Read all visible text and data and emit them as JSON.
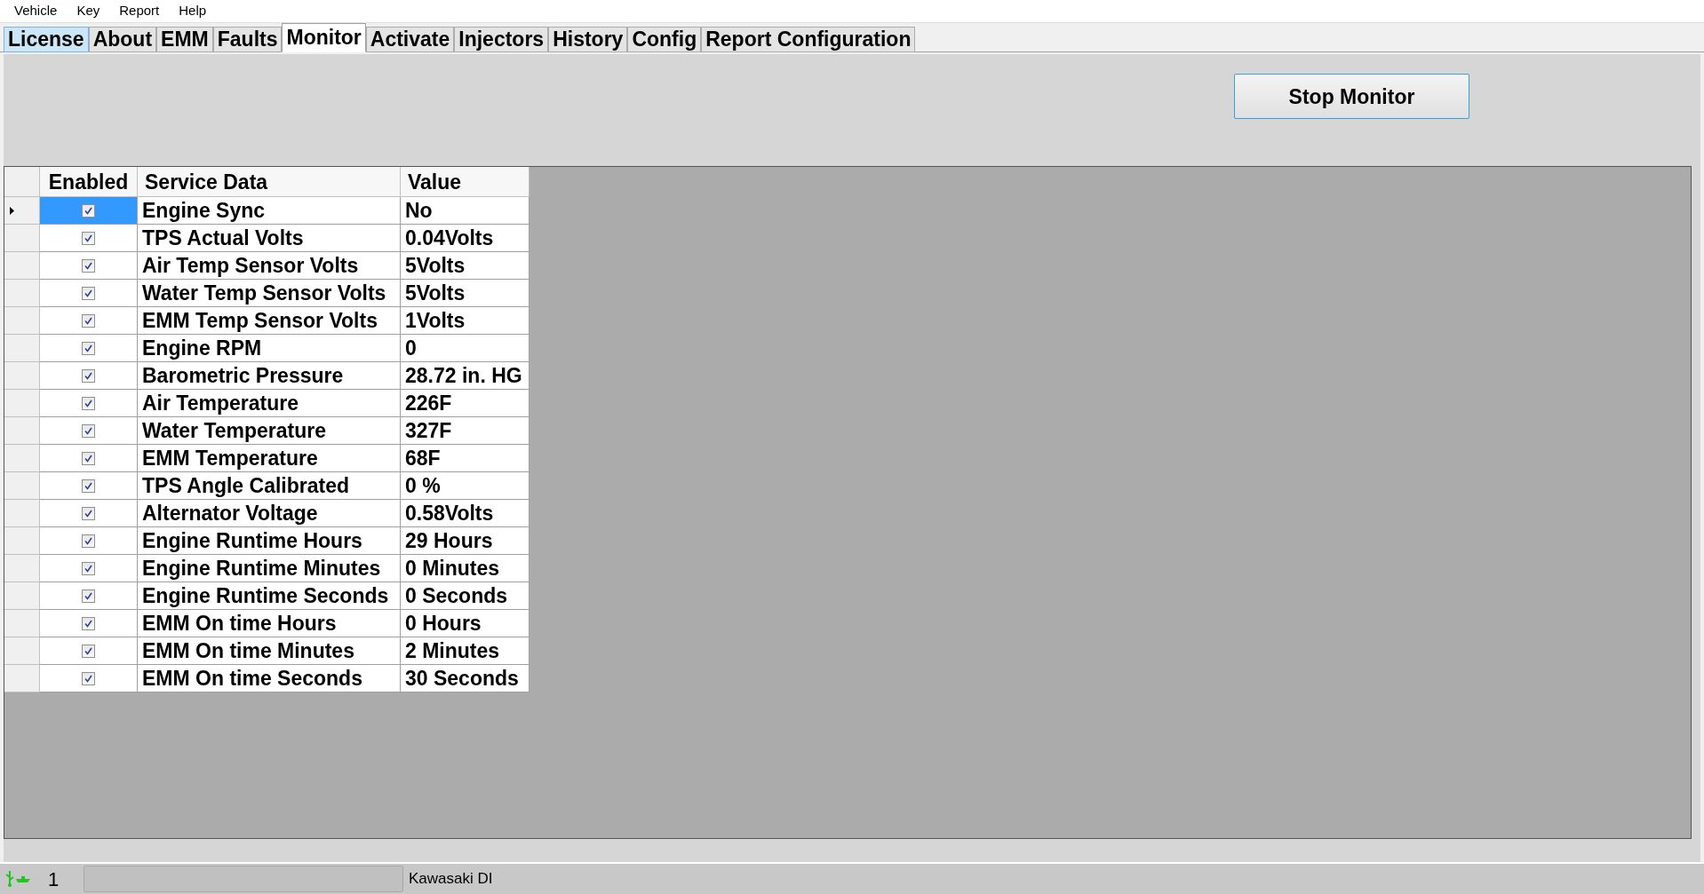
{
  "menu": [
    "Vehicle",
    "Key",
    "Report",
    "Help"
  ],
  "tabs": [
    {
      "label": "License",
      "selected": false,
      "highlighted": true
    },
    {
      "label": "About",
      "selected": false,
      "highlighted": false
    },
    {
      "label": "EMM",
      "selected": false,
      "highlighted": false
    },
    {
      "label": "Faults",
      "selected": false,
      "highlighted": false
    },
    {
      "label": "Monitor",
      "selected": true,
      "highlighted": false
    },
    {
      "label": "Activate",
      "selected": false,
      "highlighted": false
    },
    {
      "label": "Injectors",
      "selected": false,
      "highlighted": false
    },
    {
      "label": "History",
      "selected": false,
      "highlighted": false
    },
    {
      "label": "Config",
      "selected": false,
      "highlighted": false
    },
    {
      "label": "Report Configuration",
      "selected": false,
      "highlighted": false
    }
  ],
  "stop_button": "Stop Monitor",
  "table": {
    "columns": [
      "Enabled",
      "Service Data",
      "Value"
    ],
    "rows": [
      {
        "enabled": true,
        "selected": true,
        "name": "Engine Sync",
        "value": "No"
      },
      {
        "enabled": true,
        "selected": false,
        "name": "TPS Actual Volts",
        "value": "0.04Volts"
      },
      {
        "enabled": true,
        "selected": false,
        "name": "Air Temp Sensor Volts",
        "value": "5Volts"
      },
      {
        "enabled": true,
        "selected": false,
        "name": "Water Temp Sensor Volts",
        "value": "5Volts"
      },
      {
        "enabled": true,
        "selected": false,
        "name": "EMM Temp Sensor Volts",
        "value": "1Volts"
      },
      {
        "enabled": true,
        "selected": false,
        "name": "Engine RPM",
        "value": "0"
      },
      {
        "enabled": true,
        "selected": false,
        "name": "Barometric Pressure",
        "value": "28.72 in. HG"
      },
      {
        "enabled": true,
        "selected": false,
        "name": "Air Temperature",
        "value": "226F"
      },
      {
        "enabled": true,
        "selected": false,
        "name": "Water Temperature",
        "value": "327F"
      },
      {
        "enabled": true,
        "selected": false,
        "name": "EMM Temperature",
        "value": "68F"
      },
      {
        "enabled": true,
        "selected": false,
        "name": "TPS Angle Calibrated",
        "value": "0 %"
      },
      {
        "enabled": true,
        "selected": false,
        "name": "Alternator Voltage",
        "value": "0.58Volts"
      },
      {
        "enabled": true,
        "selected": false,
        "name": "Engine Runtime Hours",
        "value": "29 Hours"
      },
      {
        "enabled": true,
        "selected": false,
        "name": "Engine Runtime Minutes",
        "value": "0 Minutes"
      },
      {
        "enabled": true,
        "selected": false,
        "name": "Engine Runtime Seconds",
        "value": "0 Seconds"
      },
      {
        "enabled": true,
        "selected": false,
        "name": "EMM On time Hours",
        "value": "0 Hours"
      },
      {
        "enabled": true,
        "selected": false,
        "name": "EMM On time Minutes",
        "value": "2 Minutes"
      },
      {
        "enabled": true,
        "selected": false,
        "name": "EMM On time Seconds",
        "value": "30 Seconds"
      }
    ]
  },
  "status_bar": {
    "count": "1",
    "progress": {
      "level": 0
    },
    "device": "Kawasaki DI"
  }
}
